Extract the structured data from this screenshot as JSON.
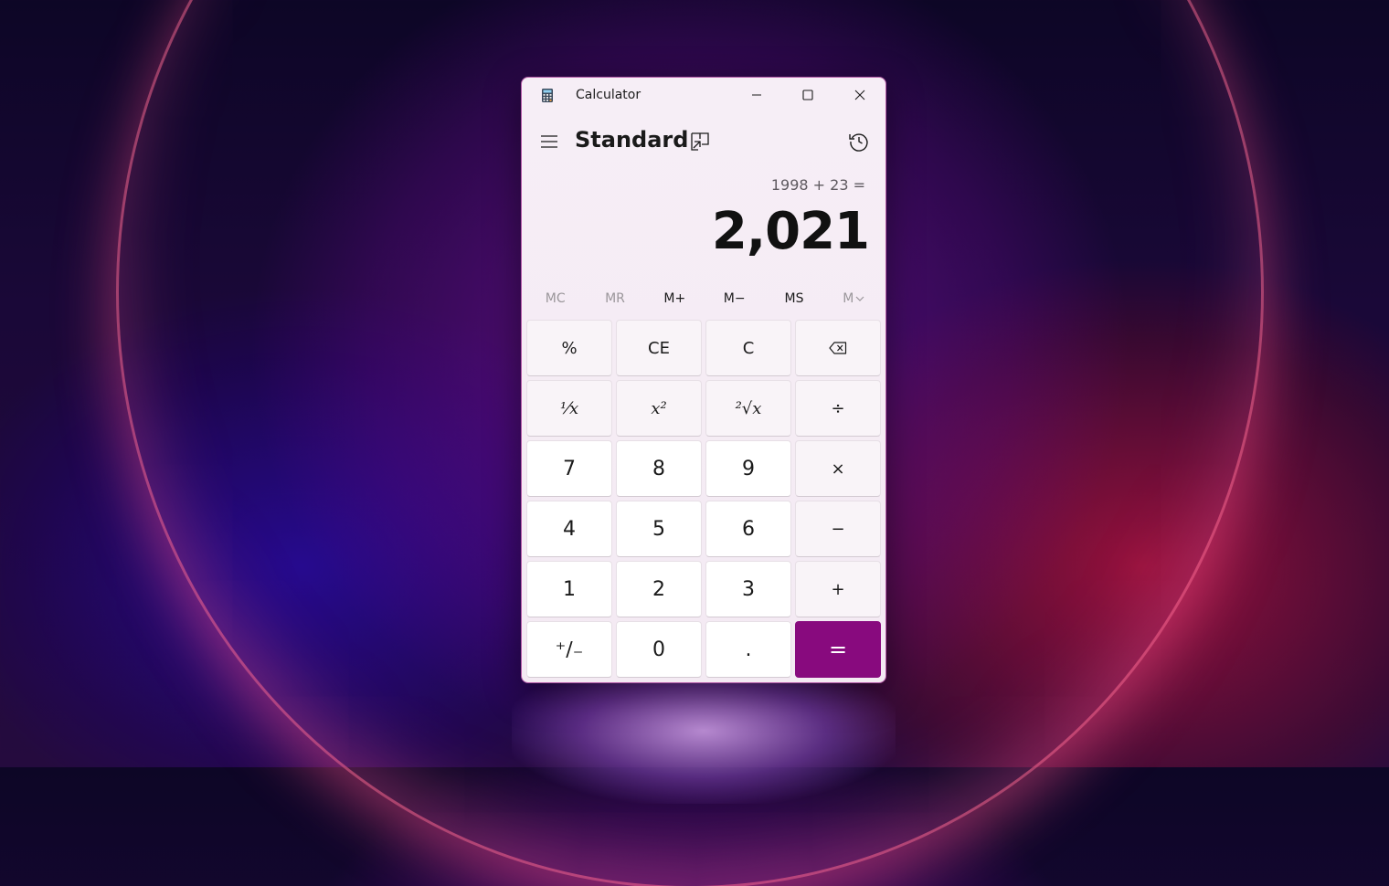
{
  "window": {
    "title": "Calculator",
    "accent_color": "#880a7e"
  },
  "header": {
    "mode": "Standard",
    "icons": [
      "hamburger-menu-icon",
      "keep-on-top-icon",
      "history-icon"
    ]
  },
  "display": {
    "expression": "1998 + 23 =",
    "result": "2,021"
  },
  "memory": {
    "mc": "MC",
    "mr": "MR",
    "m_plus": "M+",
    "m_minus": "M−",
    "ms": "MS",
    "m_list": "M"
  },
  "keys": {
    "percent": "%",
    "ce": "CE",
    "c": "C",
    "reciprocal": "⅟x",
    "square": "x²",
    "sqrt": "²√x",
    "divide": "÷",
    "seven": "7",
    "eight": "8",
    "nine": "9",
    "multiply": "×",
    "four": "4",
    "five": "5",
    "six": "6",
    "minus": "−",
    "one": "1",
    "two": "2",
    "three": "3",
    "plus": "+",
    "negate": "⁺∕₋",
    "zero": "0",
    "decimal": ".",
    "equals": "="
  }
}
